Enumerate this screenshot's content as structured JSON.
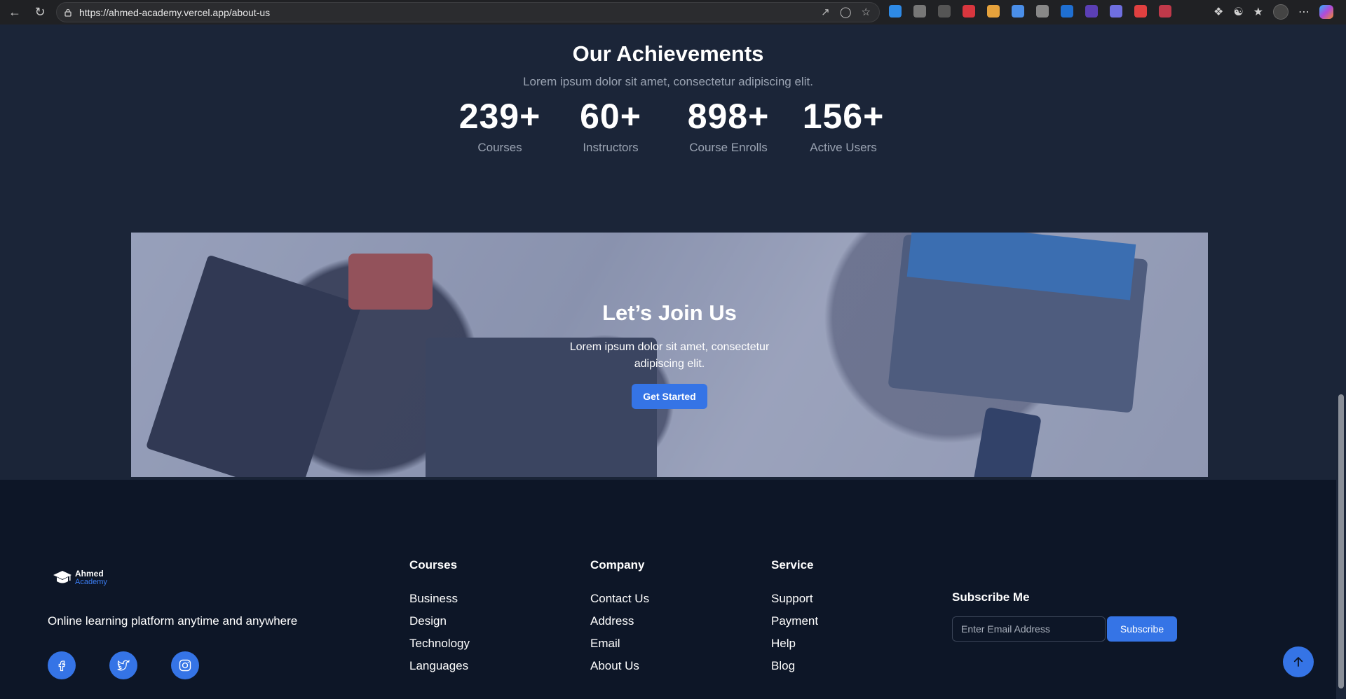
{
  "browser": {
    "url": "https://ahmed-academy.vercel.app/about-us"
  },
  "achievements": {
    "title": "Our Achievements",
    "subtitle": "Lorem ipsum dolor sit amet, consectetur adipiscing elit.",
    "stats": [
      {
        "value": "239+",
        "label": "Courses"
      },
      {
        "value": "60+",
        "label": "Instructors"
      },
      {
        "value": "898+",
        "label": "Course Enrolls"
      },
      {
        "value": "156+",
        "label": "Active Users"
      }
    ]
  },
  "banner": {
    "title": "Let’s Join Us",
    "text": "Lorem ipsum dolor sit amet, consectetur adipiscing elit.",
    "button": "Get Started"
  },
  "footer": {
    "logo": {
      "line1": "Ahmed",
      "line2": "Academy"
    },
    "tagline": "Online learning platform anytime and anywhere",
    "columns": [
      {
        "title": "Courses",
        "links": [
          "Business",
          "Design",
          "Technology",
          "Languages"
        ]
      },
      {
        "title": "Company",
        "links": [
          "Contact Us",
          "Address",
          "Email",
          "About Us"
        ]
      },
      {
        "title": "Service",
        "links": [
          "Support",
          "Payment",
          "Help",
          "Blog"
        ]
      }
    ],
    "subscribe": {
      "title": "Subscribe Me",
      "placeholder": "Enter Email Address",
      "button": "Subscribe"
    },
    "social": [
      "facebook-icon",
      "twitter-icon",
      "instagram-icon"
    ]
  },
  "colors": {
    "accent": "#3574e6",
    "page_bg": "#1b2538",
    "footer_bg": "#0d1627"
  }
}
